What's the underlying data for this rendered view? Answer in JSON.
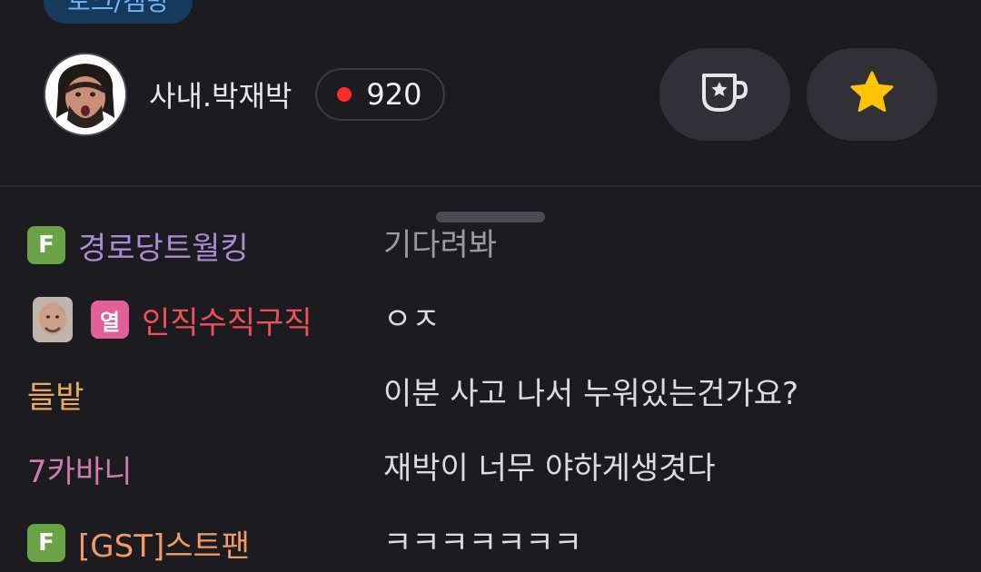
{
  "header": {
    "category_label": "토크/캠방"
  },
  "streamer": {
    "name": "사내.박재박",
    "viewer_count": "920",
    "live_dot_color": "#ff2a2a"
  },
  "actions": {
    "cup_icon": "cup-star-icon",
    "star_icon": "star-icon",
    "star_color": "#ffc400"
  },
  "chat": {
    "messages": [
      {
        "badge": "F",
        "nickname": "경로당트월킹",
        "nick_color": "#a98bd6",
        "text": "기다려봐",
        "text_color": "#9a9aa0"
      },
      {
        "badge": "열",
        "nickname": "인직수직구직",
        "nick_color": "#ef4f56",
        "text": "ㅇㅈ",
        "has_avatar": true
      },
      {
        "nickname": "들밭",
        "nick_color": "#e8a95e",
        "text": "이분 사고 나서 누워있는건가요?"
      },
      {
        "nickname": "7카바니",
        "nick_color": "#d07ab2",
        "text": "재박이 너무 야하게생겻다"
      },
      {
        "badge": "F",
        "nickname": "[GST]스트팬",
        "nick_color": "#ef9a6a",
        "text": "ㅋㅋㅋㅋㅋㅋㅋ"
      }
    ]
  }
}
